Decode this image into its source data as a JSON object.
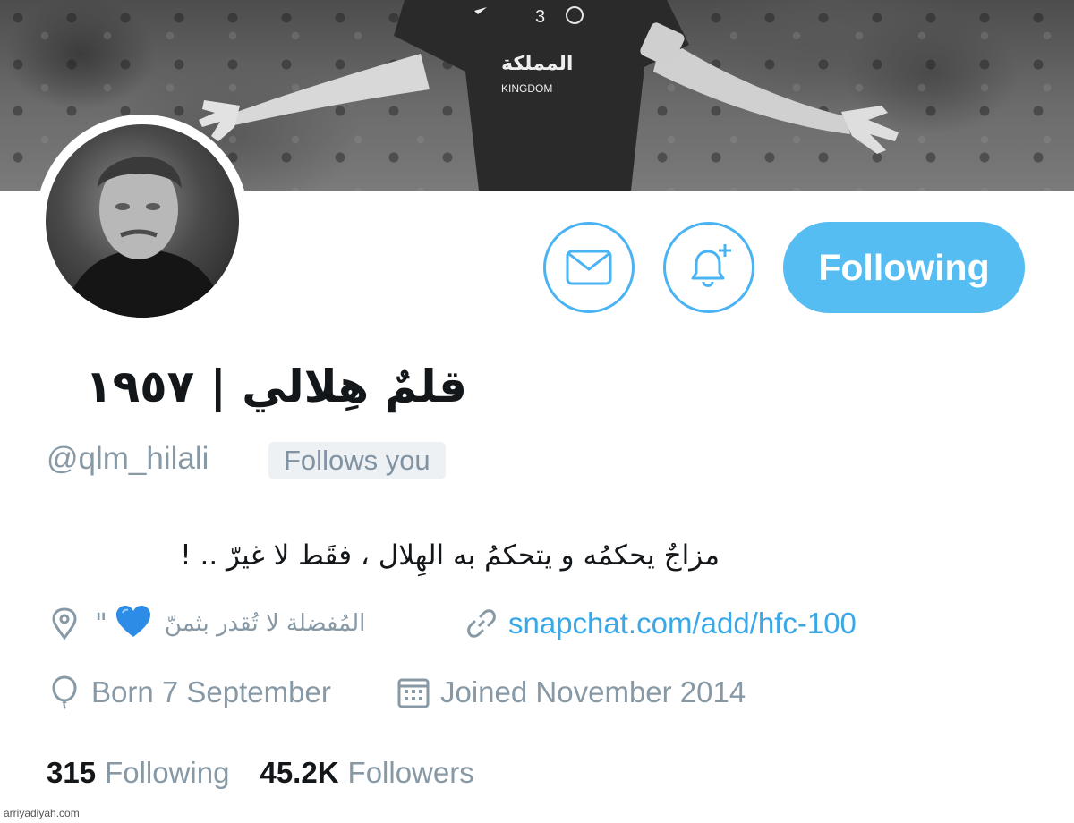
{
  "profile": {
    "display_name": "قلمٌ هِلالي | ١٩٥٧",
    "handle": "@qlm_hilali",
    "follows_you": "Follows you",
    "bio": "مزاجٌ يحكمُه و يتحكمُ به الهِلال ، فقَط لا غيرّ .. !",
    "location": "المُفضلة لا تُقدر بثمنّ",
    "location_quote": "\"",
    "link": "snapchat.com/add/hfc-100",
    "born": "Born 7 September",
    "joined": "Joined November 2014"
  },
  "actions": {
    "follow_label": "Following",
    "message_icon": "envelope-icon",
    "notify_icon": "bell-plus-icon"
  },
  "stats": {
    "following_count": "315",
    "following_label": "Following",
    "followers_count": "45.2K",
    "followers_label": "Followers"
  },
  "footer": {
    "watermark": "arriyadiyah.com"
  },
  "colors": {
    "accent": "#4ab3f4",
    "follow_button": "#55bdf2",
    "link": "#3aa8e6",
    "muted_text": "#8899a6",
    "heart": "#2d8ce6"
  }
}
